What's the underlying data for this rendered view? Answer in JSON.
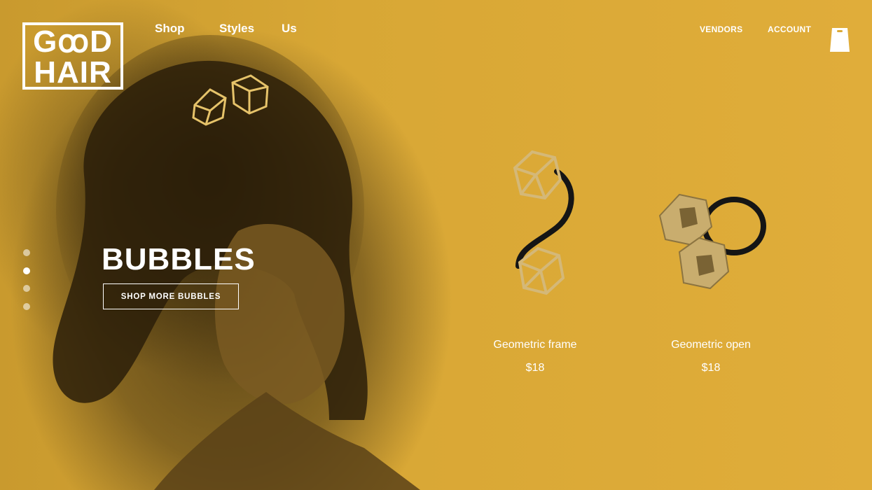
{
  "brand": {
    "logo_line1": "GꝏD",
    "logo_line2": "HAIR"
  },
  "nav": {
    "items": [
      {
        "label": "Shop"
      },
      {
        "label": "Styles"
      },
      {
        "label": "Us"
      }
    ],
    "vendors": "VENDORS",
    "account": "ACCOUNT"
  },
  "hero": {
    "title": "BUBBLES",
    "cta": "SHOP MORE BUBBLES",
    "slides": 4,
    "active_slide": 2
  },
  "products": [
    {
      "name": "Geometric frame",
      "price": "$18"
    },
    {
      "name": "Geometric open",
      "price": "$18"
    }
  ],
  "colors": {
    "background": "#dba936",
    "text": "#ffffff"
  },
  "icons": {
    "cart": "shopping-bag-icon"
  }
}
